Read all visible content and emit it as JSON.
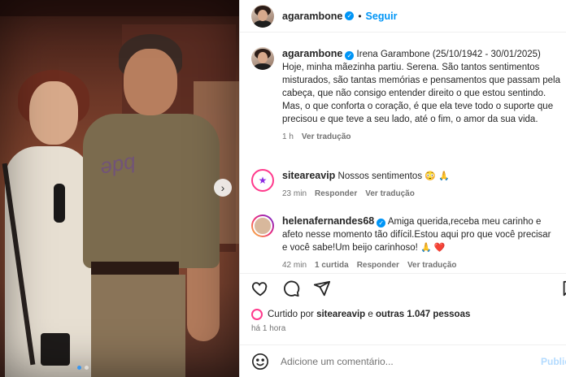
{
  "post": {
    "username": "agarambone",
    "follow_label": "Seguir",
    "separator": "•",
    "caption_title": "Irena Garambone (25/10/1942 - 30/01/2025)",
    "caption_body": "Hoje, minha mãezinha partiu. Serena. São tantos sentimentos misturados, são tantas memórias e pensamentos que passam pela cabeça, que não consigo entender direito o que estou sentindo. Mas, o que conforta o coração, é que ela teve todo o suporte que precisou e que teve a seu lado, até o fim, o amor da sua vida.",
    "caption_time": "1 h",
    "translate_label": "Ver tradução"
  },
  "comments": [
    {
      "username": "siteareavip",
      "text": "Nossos sentimentos",
      "emojis": "😳 🙏",
      "time": "23 min",
      "reply": "Responder",
      "translate": "Ver tradução"
    },
    {
      "username": "helenafernandes68",
      "text": "Amiga querida,receba meu carinho e afeto nesse momento tão difícil.Estou aqui pro que você precisar e você sabe!Um beijo carinhoso!",
      "emojis": "🙏 ❤️",
      "time": "42 min",
      "likes": "1 curtida",
      "reply": "Responder",
      "translate": "Ver tradução"
    }
  ],
  "likes": {
    "prefix": "Curtido por",
    "user": "siteareavip",
    "connector": "e",
    "others": "outras 1.047 pessoas"
  },
  "posted_time": "há 1 hora",
  "add_comment": {
    "placeholder": "Adicione um comentário...",
    "publish": "Publicar"
  },
  "icons": {
    "like": "heart-icon",
    "comment": "comment-icon",
    "share": "send-icon",
    "save": "bookmark-icon",
    "emoji": "emoji-icon",
    "next": "chevron-right-icon"
  },
  "colors": {
    "accent": "#0095f6",
    "text": "#262626",
    "muted": "#737373"
  }
}
